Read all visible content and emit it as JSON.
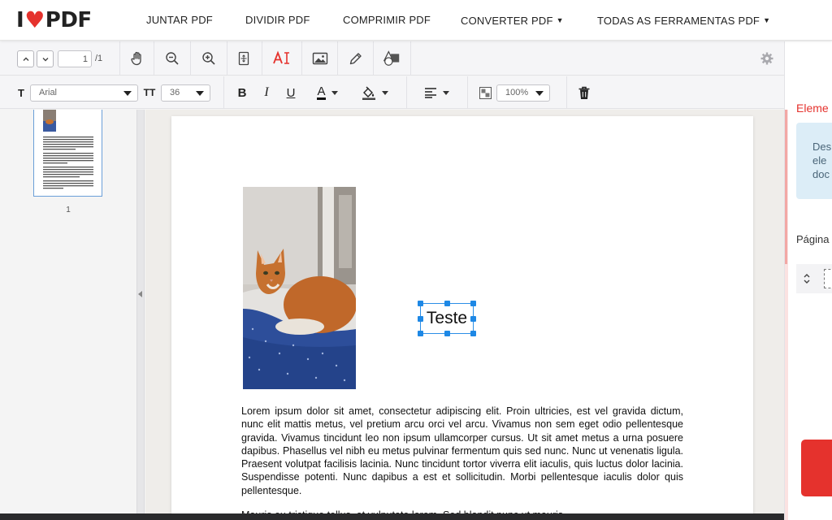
{
  "header": {
    "logo_left": "I",
    "logo_right": "PDF",
    "nav": [
      {
        "label": "JUNTAR PDF",
        "has_caret": false
      },
      {
        "label": "DIVIDIR PDF",
        "has_caret": false
      },
      {
        "label": "COMPRIMIR PDF",
        "has_caret": false
      },
      {
        "label": "CONVERTER PDF",
        "has_caret": true
      },
      {
        "label": "TODAS AS FERRAMENTAS PDF",
        "has_caret": true
      }
    ],
    "caret": "▼"
  },
  "toolbar": {
    "page_value": "1",
    "page_total": "/1",
    "tools": [
      "hand-icon",
      "zoom-out-icon",
      "zoom-in-icon",
      "fit-icon",
      "add-text-icon",
      "add-image-icon",
      "draw-icon",
      "shapes-icon",
      "settings-icon"
    ]
  },
  "format_bar": {
    "font_label": "T",
    "font_family": "Arial",
    "size_label": "TT",
    "font_size": "36",
    "bold": "B",
    "italic": "I",
    "underline": "U",
    "font_color_glyph": "A",
    "opacity": "100%"
  },
  "thumbnails": {
    "page_number": "1"
  },
  "document": {
    "text_box": "Teste",
    "paragraph": "Lorem ipsum dolor sit amet, consectetur adipiscing elit. Proin ultricies, est vel gravida dictum, nunc elit mattis metus, vel pretium arcu orci vel arcu. Vivamus non sem eget odio pellentesque gravida. Vivamus tincidunt leo non ipsum ullamcorper cursus. Ut sit amet metus a urna posuere dapibus. Phasellus vel nibh eu metus pulvinar fermentum quis sed nunc. Nunc ut venenatis ligula. Praesent volutpat facilisis lacinia. Nunc tincidunt tortor viverra elit iaculis, quis luctus dolor lacinia. Suspendisse potenti. Nunc dapibus a est et sollicitudin. Morbi pellentesque iaculis dolor quis pellentesque.",
    "paragraph2_start": "Mauris eu tristique tellus, at vulputate lorem. Sed blandit nunc ut mauris."
  },
  "right_panel": {
    "title": "Eleme",
    "info_lines": [
      "Des",
      "ele",
      "doc"
    ],
    "page_label": "Página"
  },
  "colors": {
    "brand": "#e5322d",
    "selection": "#1e88e5",
    "info_bg": "#dcedf7"
  }
}
